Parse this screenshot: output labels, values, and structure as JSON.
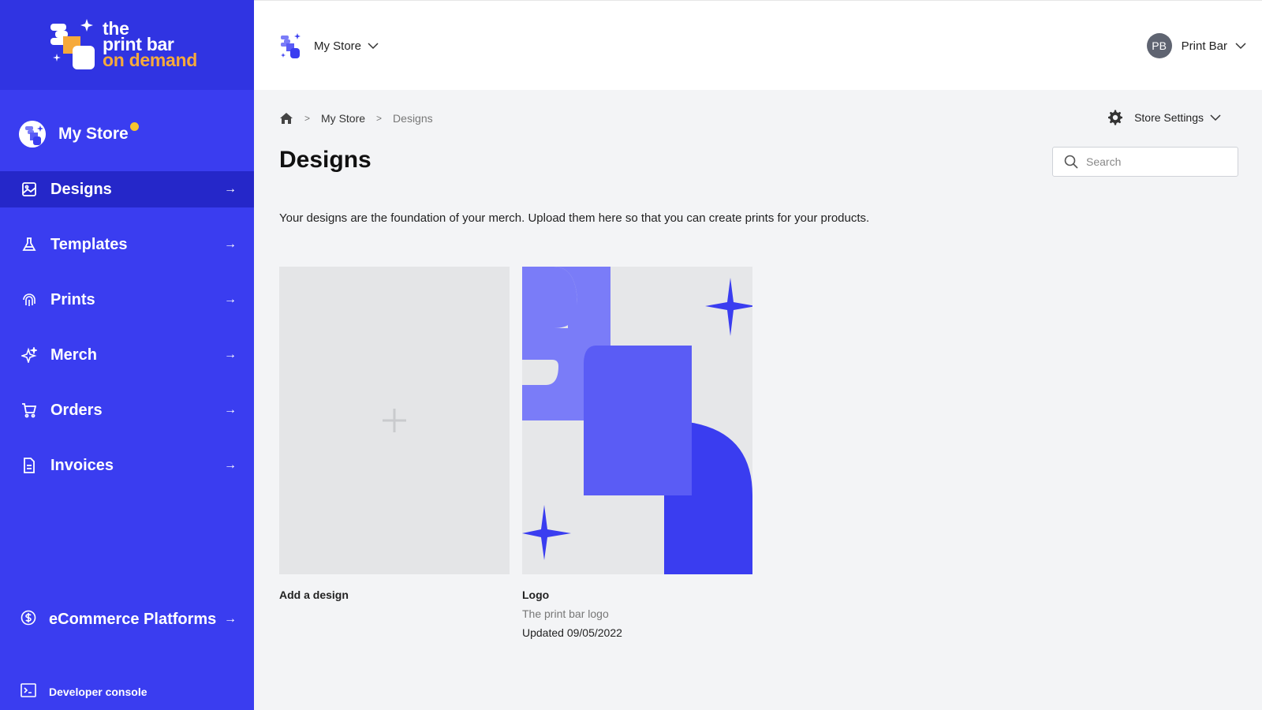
{
  "brand": {
    "line1": "the",
    "line2": "print bar",
    "line3": "on demand",
    "accent_color": "#f6a93b",
    "sidebar_color": "#3a3df0"
  },
  "sidebar": {
    "store_name": "My Store",
    "items": [
      {
        "label": "Designs",
        "icon": "image-icon",
        "active": true
      },
      {
        "label": "Templates",
        "icon": "flask-icon"
      },
      {
        "label": "Prints",
        "icon": "fingerprint-icon"
      },
      {
        "label": "Merch",
        "icon": "sparkle-icon"
      },
      {
        "label": "Orders",
        "icon": "cart-icon"
      },
      {
        "label": "Invoices",
        "icon": "document-icon"
      }
    ],
    "ecommerce_label": "eCommerce Platforms",
    "developer_label": "Developer console",
    "arrow": "→"
  },
  "topbar": {
    "store_switch_label": "My Store",
    "user_initials": "PB",
    "user_name": "Print Bar"
  },
  "breadcrumb": {
    "items": [
      "My Store",
      "Designs"
    ]
  },
  "settings": {
    "label": "Store Settings"
  },
  "page": {
    "title": "Designs",
    "search_placeholder": "Search",
    "description": "Your designs are the foundation of your merch. Upload them here so that you can create prints for your products."
  },
  "cards": {
    "add_label": "Add a design",
    "design": {
      "title": "Logo",
      "subtitle": "The print bar logo",
      "updated": "Updated 09/05/2022"
    }
  }
}
